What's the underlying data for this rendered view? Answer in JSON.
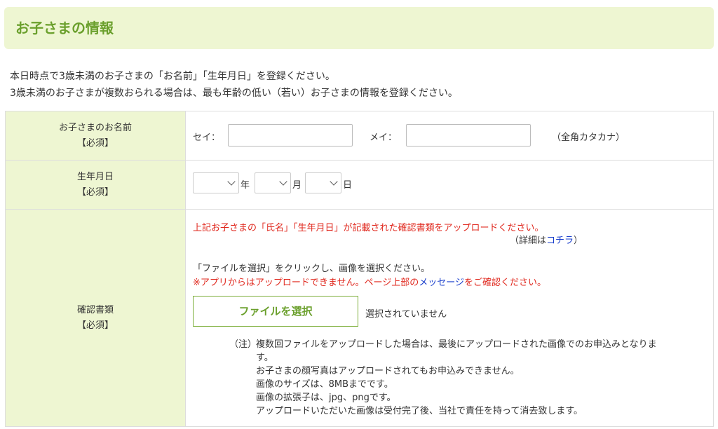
{
  "section": {
    "title": "お子さまの情報"
  },
  "intro": [
    "本日時点で3歳未満のお子さまの「お名前」「生年月日」を登録ください。",
    "3歳未満のお子さまが複数おられる場合は、最も年齢の低い（若い）お子さまの情報を登録ください。"
  ],
  "name_row": {
    "label": "お子さまのお名前",
    "required": "【必須】",
    "sei_label": "セイ：",
    "sei_value": "",
    "mei_label": "メイ：",
    "mei_value": "",
    "hint": "（全角カタカナ）"
  },
  "birth_row": {
    "label": "生年月日",
    "required": "【必須】",
    "year_suffix": "年",
    "month_suffix": "月",
    "day_suffix": "日",
    "year_value": "",
    "month_value": "",
    "day_value": ""
  },
  "doc_row": {
    "label": "確認書類",
    "required": "【必須】",
    "upload_notice": "上記お子さまの「氏名」「生年月日」が記載された確認書類をアップロードください。",
    "detail_prefix": "（詳細は",
    "detail_link": "コチラ",
    "detail_suffix": "）",
    "instruction": "「ファイルを選択」をクリックし、画像を選択ください。",
    "warning_prefix": "※アプリからはアップロードできません。ページ上部の",
    "warning_link": "メッセージ",
    "warning_suffix": "をご確認ください。",
    "file_button": "ファイルを選択",
    "file_status": "選択されていません",
    "note_prefix": "（注）",
    "notes": [
      "複数回ファイルをアップロードした場合は、最後にアップロードされた画像でのお申込みとなりま",
      "す。",
      "お子さまの顔写真はアップロードされてもお申込みできません。",
      "画像のサイズは、8MBまでです。",
      "画像の拡張子は、jpg、pngです。",
      "アップロードいただいた画像は受付完了後、当社で責任を持って消去致します。"
    ]
  }
}
